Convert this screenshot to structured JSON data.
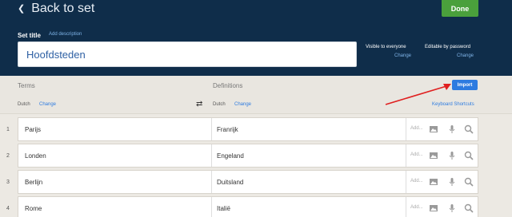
{
  "header": {
    "back_label": "Back to set",
    "done_label": "Done",
    "set_title_label": "Set title",
    "add_description": "Add description",
    "title_value": "Hoofdsteden",
    "visibility_label": "Visible to everyone",
    "visibility_change": "Change",
    "editable_label": "Editable by password",
    "editable_change": "Change"
  },
  "terms_bar": {
    "terms_header": "Terms",
    "definitions_header": "Definitions",
    "import_label": "Import",
    "term_language": "Dutch",
    "term_language_change": "Change",
    "def_language": "Dutch",
    "def_language_change": "Change",
    "keyboard_shortcuts": "Keyboard Shortcuts"
  },
  "rows": [
    {
      "num": "1",
      "term": "Parijs",
      "definition": "Franrijk",
      "add": "Add..."
    },
    {
      "num": "2",
      "term": "Londen",
      "definition": "Engeland",
      "add": "Add..."
    },
    {
      "num": "3",
      "term": "Berlijn",
      "definition": "Duitsland",
      "add": "Add..."
    },
    {
      "num": "4",
      "term": "Rome",
      "definition": "Italië",
      "add": "Add..."
    }
  ],
  "colors": {
    "header_bg": "#0f2d4a",
    "done_green": "#4aa03c",
    "import_blue": "#2d7be0",
    "annotation_arrow": "#e02020"
  }
}
